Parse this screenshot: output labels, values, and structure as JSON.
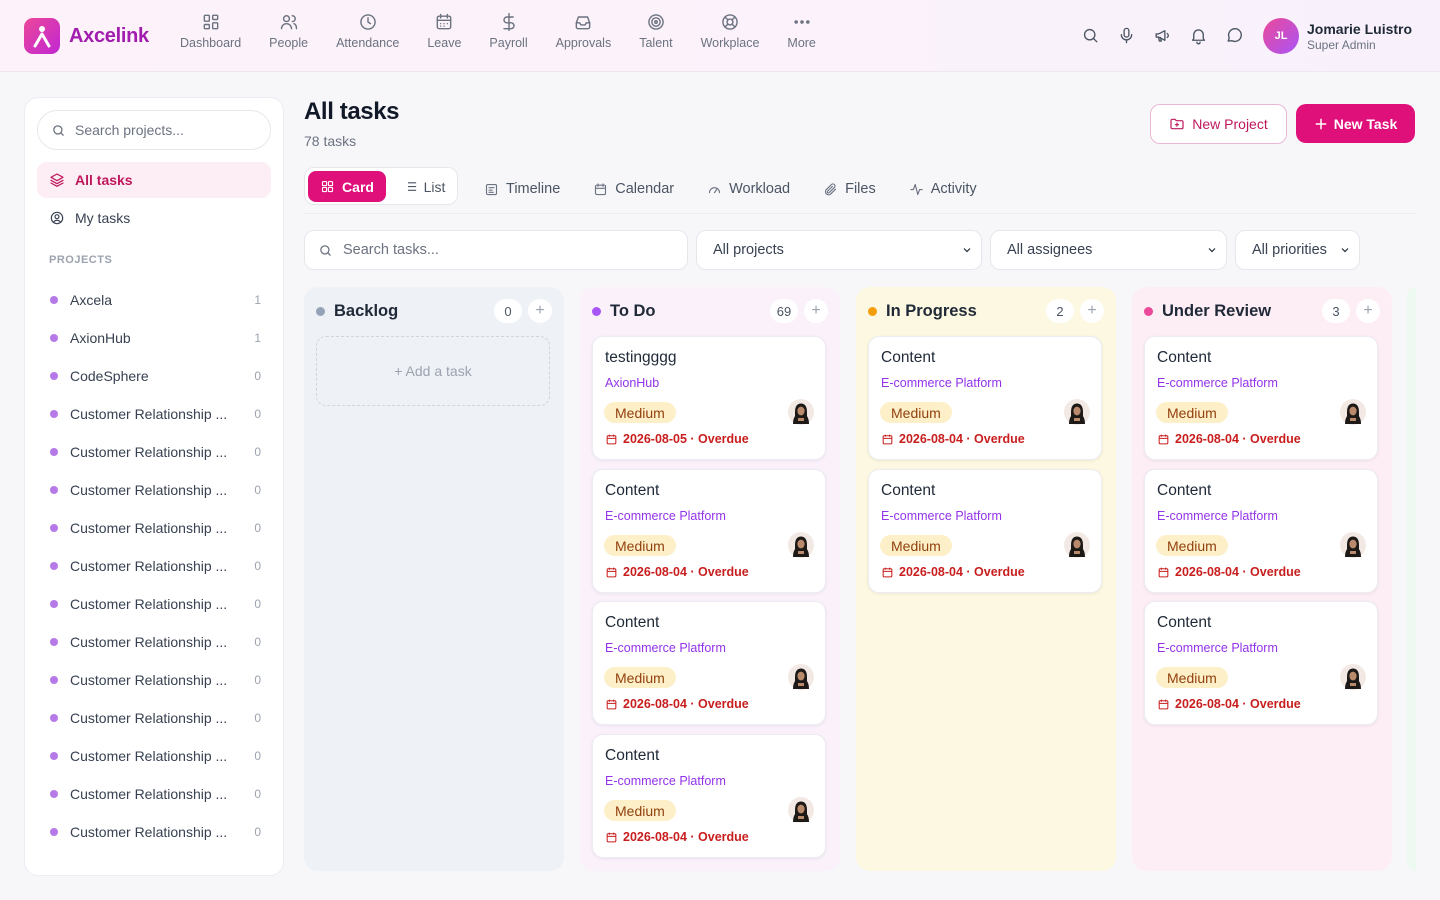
{
  "brand": {
    "name": "Axcelink"
  },
  "nav": [
    {
      "label": "Dashboard",
      "icon": "dashboard-icon"
    },
    {
      "label": "People",
      "icon": "people-icon"
    },
    {
      "label": "Attendance",
      "icon": "clock-icon"
    },
    {
      "label": "Leave",
      "icon": "calendar-icon"
    },
    {
      "label": "Payroll",
      "icon": "dollar-icon"
    },
    {
      "label": "Approvals",
      "icon": "inbox-icon"
    },
    {
      "label": "Talent",
      "icon": "target-icon"
    },
    {
      "label": "Workplace",
      "icon": "lifebuoy-icon"
    },
    {
      "label": "More",
      "icon": "more-icon"
    }
  ],
  "user": {
    "initials": "JL",
    "name": "Jomarie Luistro",
    "role": "Super Admin"
  },
  "sidebar": {
    "search_placeholder": "Search projects...",
    "all_tasks": "All tasks",
    "my_tasks": "My tasks",
    "projects_heading": "PROJECTS",
    "projects": [
      {
        "name": "Axcela",
        "count": "1"
      },
      {
        "name": "AxionHub",
        "count": "1"
      },
      {
        "name": "CodeSphere",
        "count": "0"
      },
      {
        "name": "Customer Relationship ...",
        "count": "0"
      },
      {
        "name": "Customer Relationship ...",
        "count": "0"
      },
      {
        "name": "Customer Relationship ...",
        "count": "0"
      },
      {
        "name": "Customer Relationship ...",
        "count": "0"
      },
      {
        "name": "Customer Relationship ...",
        "count": "0"
      },
      {
        "name": "Customer Relationship ...",
        "count": "0"
      },
      {
        "name": "Customer Relationship ...",
        "count": "0"
      },
      {
        "name": "Customer Relationship ...",
        "count": "0"
      },
      {
        "name": "Customer Relationship ...",
        "count": "0"
      },
      {
        "name": "Customer Relationship ...",
        "count": "0"
      },
      {
        "name": "Customer Relationship ...",
        "count": "0"
      },
      {
        "name": "Customer Relationship ...",
        "count": "0"
      }
    ]
  },
  "main": {
    "title": "All tasks",
    "subtitle": "78 tasks",
    "new_project": "New Project",
    "new_task": "New Task",
    "view_card": "Card",
    "view_list": "List",
    "tabs": [
      "Timeline",
      "Calendar",
      "Workload",
      "Files",
      "Activity"
    ],
    "search_placeholder": "Search tasks...",
    "filter_projects": "All projects",
    "filter_assignees": "All assignees",
    "filter_priorities": "All priorities"
  },
  "board": {
    "add_task_label": "+ Add a task",
    "columns": [
      {
        "title": "Backlog",
        "count": "0",
        "color": "#94a3b8",
        "bg": "#eef1f6",
        "cards": []
      },
      {
        "title": "To Do",
        "count": "69",
        "color": "#a855f7",
        "bg": "#faf1fb",
        "cards": [
          {
            "title": "testingggg",
            "project": "AxionHub",
            "priority": "Medium",
            "due": "2026-08-05 · Overdue"
          },
          {
            "title": "Content",
            "project": "E-commerce Platform",
            "priority": "Medium",
            "due": "2026-08-04 · Overdue"
          },
          {
            "title": "Content",
            "project": "E-commerce Platform",
            "priority": "Medium",
            "due": "2026-08-04 · Overdue"
          },
          {
            "title": "Content",
            "project": "E-commerce Platform",
            "priority": "Medium",
            "due": "2026-08-04 · Overdue"
          }
        ]
      },
      {
        "title": "In Progress",
        "count": "2",
        "color": "#f59e0b",
        "bg": "#fdf8e1",
        "cards": [
          {
            "title": "Content",
            "project": "E-commerce Platform",
            "priority": "Medium",
            "due": "2026-08-04 · Overdue"
          },
          {
            "title": "Content",
            "project": "E-commerce Platform",
            "priority": "Medium",
            "due": "2026-08-04 · Overdue"
          }
        ]
      },
      {
        "title": "Under Review",
        "count": "3",
        "color": "#ec4899",
        "bg": "#fdeef5",
        "cards": [
          {
            "title": "Content",
            "project": "E-commerce Platform",
            "priority": "Medium",
            "due": "2026-08-04 · Overdue"
          },
          {
            "title": "Content",
            "project": "E-commerce Platform",
            "priority": "Medium",
            "due": "2026-08-04 · Overdue"
          },
          {
            "title": "Content",
            "project": "E-commerce Platform",
            "priority": "Medium",
            "due": "2026-08-04 · Overdue"
          }
        ]
      }
    ]
  }
}
